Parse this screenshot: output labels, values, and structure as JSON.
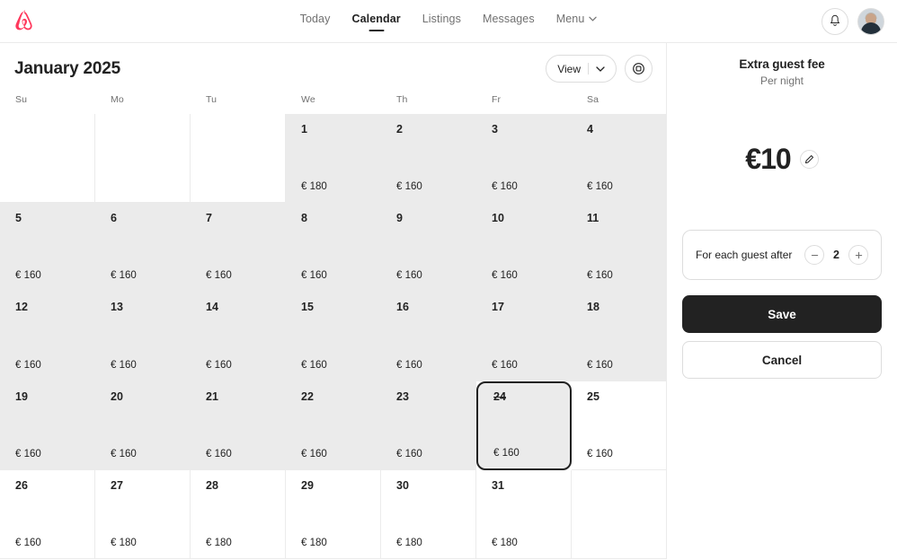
{
  "header": {
    "logo_name": "airbnb-logo",
    "brand_color": "#FF385C",
    "nav": [
      {
        "label": "Today",
        "active": false
      },
      {
        "label": "Calendar",
        "active": true
      },
      {
        "label": "Listings",
        "active": false
      },
      {
        "label": "Messages",
        "active": false
      },
      {
        "label": "Menu",
        "active": false,
        "has_chevron": true
      }
    ],
    "notifications_icon": "bell-icon",
    "avatar_alt": "user-avatar"
  },
  "calendar": {
    "month_title": "January 2025",
    "view_button": {
      "label": "View",
      "chevron": "chevron-down-icon"
    },
    "settings_button_icon": "target-settings-icon",
    "day_headers": [
      "Su",
      "Mo",
      "Tu",
      "We",
      "Th",
      "Fr",
      "Sa"
    ],
    "past_cell_bg": "#EBEBEB",
    "selected_border_color": "#222222",
    "cells": [
      {
        "day": "",
        "price": "",
        "state": "blank"
      },
      {
        "day": "",
        "price": "",
        "state": "blank"
      },
      {
        "day": "",
        "price": "",
        "state": "blank"
      },
      {
        "day": "1",
        "price": "€ 180",
        "state": "past"
      },
      {
        "day": "2",
        "price": "€ 160",
        "state": "past"
      },
      {
        "day": "3",
        "price": "€ 160",
        "state": "past"
      },
      {
        "day": "4",
        "price": "€ 160",
        "state": "past"
      },
      {
        "day": "5",
        "price": "€ 160",
        "state": "past"
      },
      {
        "day": "6",
        "price": "€ 160",
        "state": "past"
      },
      {
        "day": "7",
        "price": "€ 160",
        "state": "past"
      },
      {
        "day": "8",
        "price": "€ 160",
        "state": "past"
      },
      {
        "day": "9",
        "price": "€ 160",
        "state": "past"
      },
      {
        "day": "10",
        "price": "€ 160",
        "state": "past"
      },
      {
        "day": "11",
        "price": "€ 160",
        "state": "past"
      },
      {
        "day": "12",
        "price": "€ 160",
        "state": "past"
      },
      {
        "day": "13",
        "price": "€ 160",
        "state": "past"
      },
      {
        "day": "14",
        "price": "€ 160",
        "state": "past"
      },
      {
        "day": "15",
        "price": "€ 160",
        "state": "past"
      },
      {
        "day": "16",
        "price": "€ 160",
        "state": "past"
      },
      {
        "day": "17",
        "price": "€ 160",
        "state": "past"
      },
      {
        "day": "18",
        "price": "€ 160",
        "state": "past"
      },
      {
        "day": "19",
        "price": "€ 160",
        "state": "past"
      },
      {
        "day": "20",
        "price": "€ 160",
        "state": "past"
      },
      {
        "day": "21",
        "price": "€ 160",
        "state": "past"
      },
      {
        "day": "22",
        "price": "€ 160",
        "state": "past"
      },
      {
        "day": "23",
        "price": "€ 160",
        "state": "past"
      },
      {
        "day": "24",
        "price": "€ 160",
        "state": "selected"
      },
      {
        "day": "25",
        "price": "€ 160",
        "state": "available"
      },
      {
        "day": "26",
        "price": "€ 160",
        "state": "available"
      },
      {
        "day": "27",
        "price": "€ 180",
        "state": "available"
      },
      {
        "day": "28",
        "price": "€ 180",
        "state": "available"
      },
      {
        "day": "29",
        "price": "€ 180",
        "state": "available"
      },
      {
        "day": "30",
        "price": "€ 180",
        "state": "available"
      },
      {
        "day": "31",
        "price": "€ 180",
        "state": "available"
      },
      {
        "day": "",
        "price": "",
        "state": "blank"
      }
    ]
  },
  "panel": {
    "title": "Extra guest fee",
    "subtitle": "Per night",
    "price": "€10",
    "edit_icon": "pencil-icon",
    "stepper": {
      "label": "For each guest after",
      "value": "2",
      "decrement_icon": "minus-icon",
      "increment_icon": "plus-icon"
    },
    "save_label": "Save",
    "cancel_label": "Cancel"
  }
}
